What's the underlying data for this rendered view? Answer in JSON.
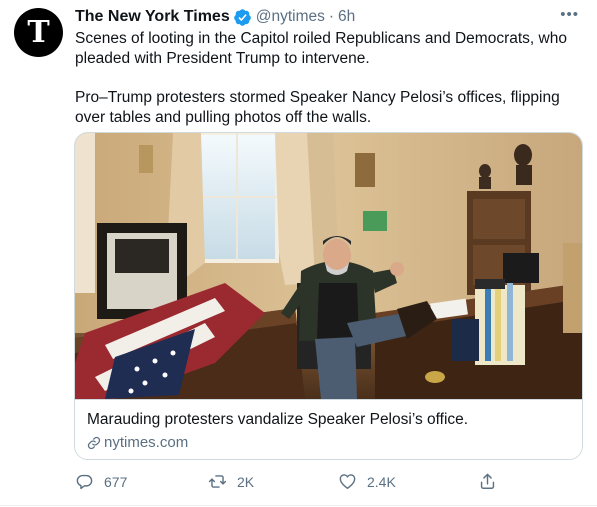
{
  "tweet": {
    "author": {
      "name": "The New York Times",
      "handle": "@nytimes",
      "separator": "·",
      "time": "6h",
      "avatar_glyph": "T",
      "verified": true
    },
    "more_label": "•••",
    "paragraphs": [
      "Scenes of looting in the Capitol roiled Republicans and Democrats, who pleaded with President Trump to intervene.",
      "Pro–Trump protesters stormed Speaker Nancy Pelosi’s offices, flipping over tables and pulling photos off the walls."
    ],
    "card": {
      "title": "Marauding protesters vandalize Speaker Pelosi’s office.",
      "domain": "nytimes.com",
      "link_icon": "link-icon",
      "image_icon": "office-photo"
    },
    "actions": {
      "reply": {
        "icon": "reply-icon",
        "count": "677"
      },
      "retweet": {
        "icon": "retweet-icon",
        "count": "2K"
      },
      "like": {
        "icon": "heart-icon",
        "count": "2.4K"
      },
      "share": {
        "icon": "share-icon"
      }
    }
  },
  "colors": {
    "text": "#0f1419",
    "secondary": "#5b7083",
    "border": "#cfd9de",
    "verified": "#1d9bf0"
  }
}
